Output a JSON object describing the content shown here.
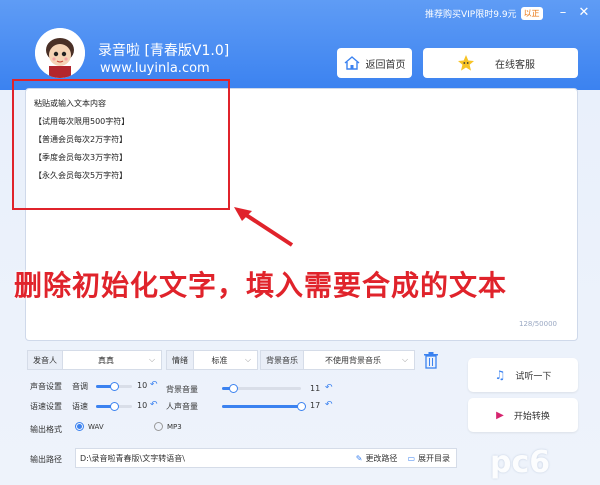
{
  "header": {
    "vip_text": "推荐购买VIP限时9.9元",
    "vip_badge": "以正",
    "app_title": "录音啦 [青春版V1.0]",
    "app_url": "www.luyinla.com",
    "home_button": "返回首页",
    "service_button": "在线客服"
  },
  "editor": {
    "lines": [
      "粘贴或输入文本内容",
      "【试用每次限用500字符】",
      "【普通会员每次2万字符】",
      "【季度会员每次3万字符】",
      "【永久会员每次5万字符】"
    ],
    "counter": "128/50000"
  },
  "annotation": "删除初始化文字，填入需要合成的文本",
  "controls": {
    "speaker_label": "发音人",
    "speaker_value": "真真",
    "emotion_label": "情绪",
    "emotion_value": "标准",
    "bgm_label": "背景音乐",
    "bgm_value": "不使用背景音乐",
    "voice_setting_label": "声音设置",
    "speed_setting_label": "语速设置",
    "pitch_label": "音调",
    "pitch_value": "10",
    "pitch_fraction": 0.5,
    "speed_label": "语速",
    "speed_value": "10",
    "speed_fraction": 0.5,
    "bg_volume_label": "背景音量",
    "bg_volume_value": "11",
    "bg_volume_fraction": 0.14,
    "voice_volume_label": "人声音量",
    "voice_volume_value": "17",
    "voice_volume_fraction": 1.0,
    "output_format_label": "输出格式",
    "format_wav": "WAV",
    "format_mp3": "MP3",
    "output_path_label": "输出路径",
    "output_path_value": "D:\\录音啦青春版\\文字转语音\\",
    "change_path": "更改路径",
    "open_dir": "展开目录"
  },
  "actions": {
    "listen": "试听一下",
    "convert": "开始转换"
  },
  "watermark": "pc6",
  "colors": {
    "accent": "#3b82f0",
    "annotation": "#e0232b"
  }
}
